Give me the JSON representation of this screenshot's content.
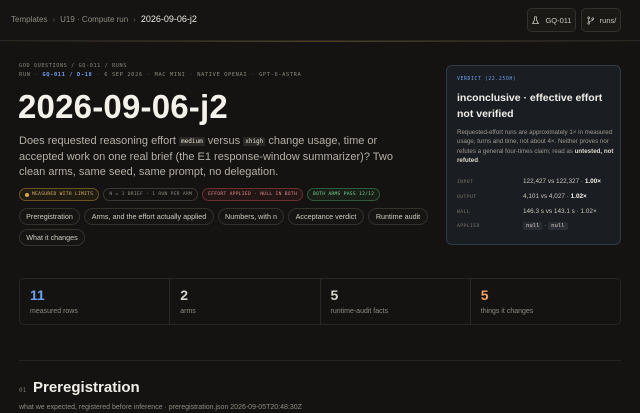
{
  "breadcrumbs": {
    "root": "Templates",
    "section": "U19 · Compute run",
    "current": "2026-09-06-j2"
  },
  "topbar": {
    "id_button": "GQ-011",
    "runs_button": "runs/"
  },
  "header": {
    "eyebrow": "GOD QUESTIONS / GQ-011 / RUNS",
    "meta": {
      "run_label": "RUN",
      "run_id": "GQ-011 / D-18",
      "date": "6 SEP 2026",
      "machine": "MAC MINI",
      "backend": "NATIVE OPENAI",
      "model": "GPT-6-ASTRA"
    },
    "title": "2026-09-06-j2",
    "desc": {
      "p1": "Does requested reasoning effort ",
      "c1": "medium",
      "p2": " versus ",
      "c2": "xhigh",
      "p3": " change usage, time or accepted work on one real brief (the E1 response-window summarizer)? Two clean arms, same seed, same prompt, no delegation."
    }
  },
  "badges": [
    "MEASURED WITH LIMITS",
    "N = 1 BRIEF · 1 RUN PER ARM",
    "EFFORT APPLIED · NULL IN BOTH",
    "BOTH ARMS PASS 12/12"
  ],
  "nav": [
    "Preregistration",
    "Arms, and the effort actually applied",
    "Numbers, with n",
    "Acceptance verdict",
    "Runtime audit",
    "What it changes"
  ],
  "verdict": {
    "tag": "VERDICT (22.25OH)",
    "headline": "inconclusive · effective effort not verified",
    "body_p1": "Requested-effort runs are approximately 1× in measured usage, turns and time, not about 4×. Neither proves nor refutes a general four-times claim; read as ",
    "body_b": "untested, not refuted",
    "body_p2": ".",
    "rows": {
      "input_label": "INPUT",
      "input_value": "122,427 vs 122,327 · ",
      "input_ratio": "1.00×",
      "output_label": "OUTPUT",
      "output_value": "4,101 vs 4,027 · ",
      "output_ratio": "1.02×",
      "wall_label": "WALL",
      "wall_value": "146.3 s vs 143.1 s · 1.02×",
      "applied_label": "APPLIED",
      "applied_a": "null",
      "applied_sep": " · ",
      "applied_b": "null"
    }
  },
  "stats": [
    {
      "value": "11",
      "label": "measured rows",
      "color": "#6fa0f0"
    },
    {
      "value": "2",
      "label": "arms",
      "color": "#d8d4cc"
    },
    {
      "value": "5",
      "label": "runtime-audit facts",
      "color": "#d8d4cc"
    },
    {
      "value": "5",
      "label": "things it changes",
      "color": "#f0a560"
    }
  ],
  "section": {
    "number": "01",
    "title": "Preregistration",
    "subtitle": "what we expected, registered before inference · preregistration.json 2026-09-05T20:48:30Z"
  }
}
